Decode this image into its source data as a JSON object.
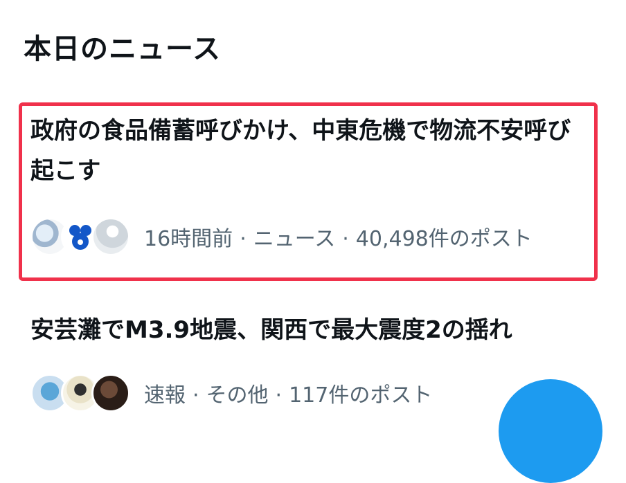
{
  "section": {
    "title": "本日のニュース"
  },
  "news": [
    {
      "headline": "政府の食品備蓄呼びかけ、中東危機で物流不安呼び起こす",
      "time": "16時間前",
      "category": "ニュース",
      "posts": "40,498件のポスト",
      "separator": "·",
      "avatars": [
        "user-avatar-icon",
        "character-logo-icon",
        "user-avatar-icon"
      ]
    },
    {
      "headline": "安芸灘でM3.9地震、関西で最大震度2の揺れ",
      "time": "速報",
      "category": "その他",
      "posts": "117件のポスト",
      "separator": "·",
      "avatars": [
        "mascot-avatar-icon",
        "cartoon-avatar-icon",
        "photo-avatar-icon"
      ]
    }
  ],
  "colors": {
    "highlight_border": "#f0314b",
    "meta_text": "#536471",
    "fab": "#1d9bf0"
  },
  "fab_icon": "compose-icon"
}
